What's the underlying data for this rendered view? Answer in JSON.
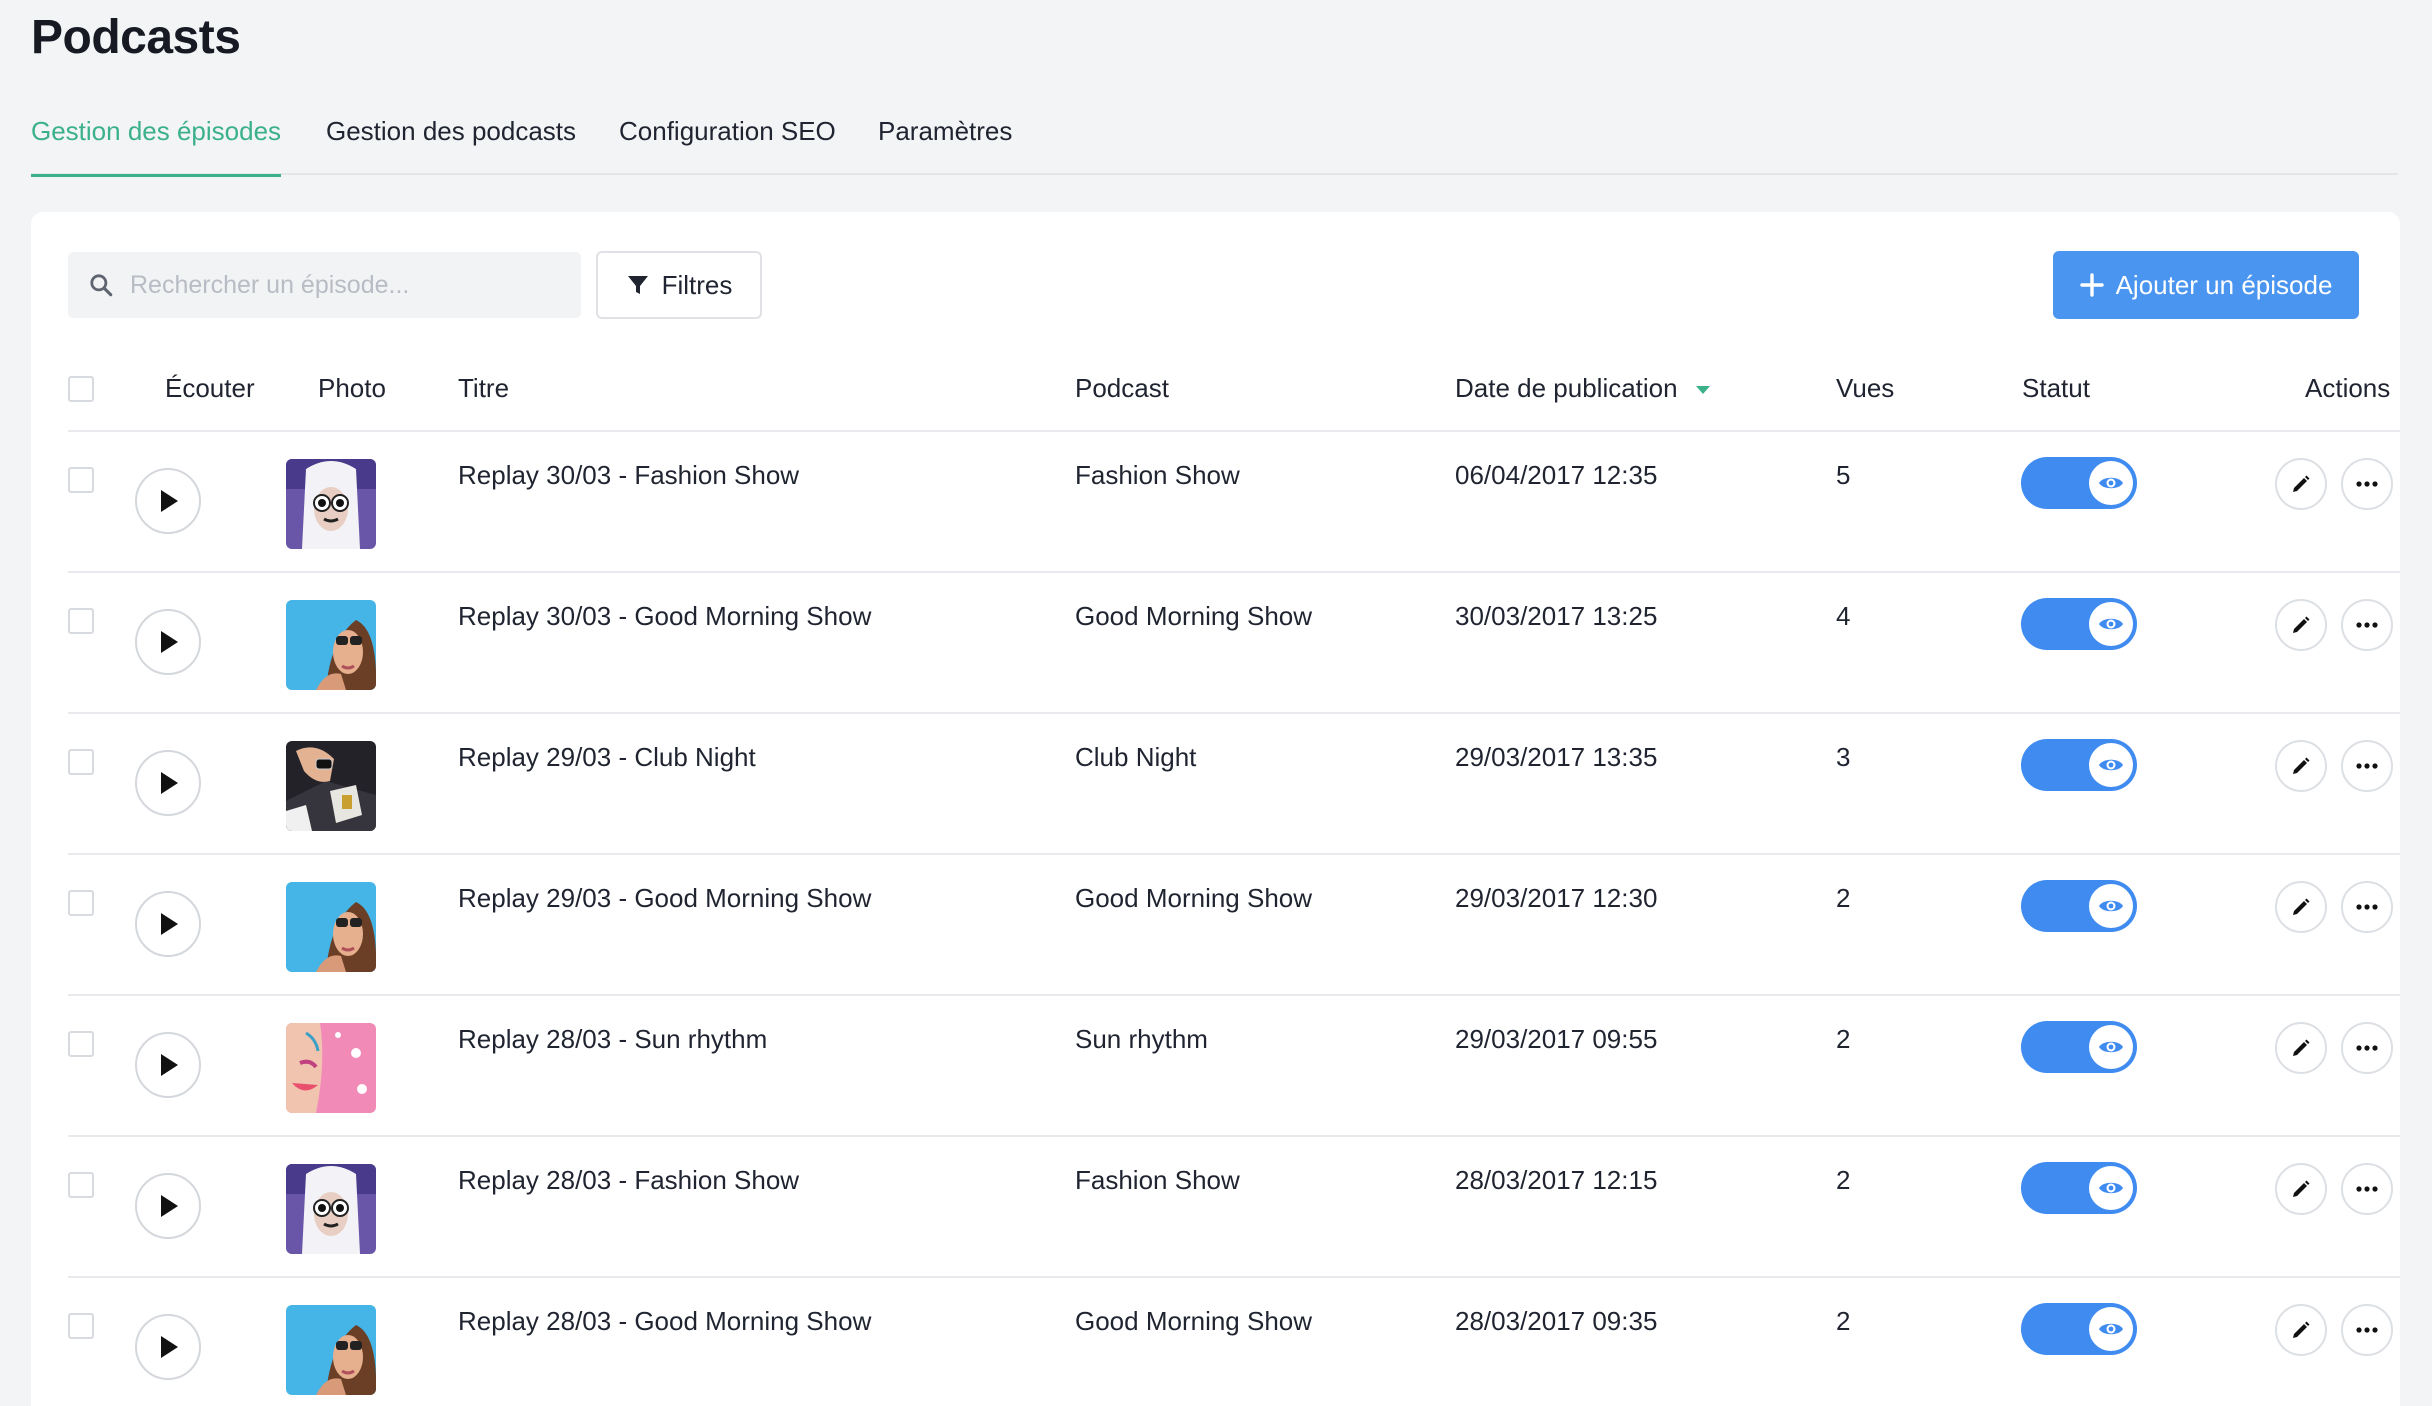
{
  "page": {
    "title": "Podcasts"
  },
  "tabs": [
    {
      "label": "Gestion des épisodes",
      "active": true
    },
    {
      "label": "Gestion des podcasts",
      "active": false
    },
    {
      "label": "Configuration SEO",
      "active": false
    },
    {
      "label": "Paramètres",
      "active": false
    }
  ],
  "toolbar": {
    "search_placeholder": "Rechercher un épisode...",
    "filter_label": "Filtres",
    "add_label": "Ajouter un épisode"
  },
  "table": {
    "headers": {
      "listen": "Écouter",
      "photo": "Photo",
      "title": "Titre",
      "podcast": "Podcast",
      "date": "Date de publication",
      "views": "Vues",
      "status": "Statut",
      "actions": "Actions"
    },
    "sort_column": "date",
    "sort_direction": "desc",
    "rows": [
      {
        "title": "Replay 30/03 - Fashion Show",
        "podcast": "Fashion Show",
        "date": "06/04/2017 12:35",
        "views": "5",
        "status_on": true,
        "photo": "fashion"
      },
      {
        "title": "Replay 30/03 - Good Morning Show",
        "podcast": "Good Morning Show",
        "date": "30/03/2017 13:25",
        "views": "4",
        "status_on": true,
        "photo": "morning"
      },
      {
        "title": "Replay 29/03 - Club Night",
        "podcast": "Club Night",
        "date": "29/03/2017 13:35",
        "views": "3",
        "status_on": true,
        "photo": "club"
      },
      {
        "title": "Replay 29/03 - Good Morning Show",
        "podcast": "Good Morning Show",
        "date": "29/03/2017 12:30",
        "views": "2",
        "status_on": true,
        "photo": "morning"
      },
      {
        "title": "Replay 28/03 - Sun rhythm",
        "podcast": "Sun rhythm",
        "date": "29/03/2017 09:55",
        "views": "2",
        "status_on": true,
        "photo": "sun"
      },
      {
        "title": "Replay 28/03 - Fashion Show",
        "podcast": "Fashion Show",
        "date": "28/03/2017 12:15",
        "views": "2",
        "status_on": true,
        "photo": "fashion"
      },
      {
        "title": "Replay 28/03 - Good Morning Show",
        "podcast": "Good Morning Show",
        "date": "28/03/2017 09:35",
        "views": "2",
        "status_on": true,
        "photo": "morning"
      }
    ]
  },
  "colors": {
    "accent_green": "#3bb18a",
    "primary_blue": "#4a95f0",
    "toggle_blue": "#3f8bf0"
  }
}
